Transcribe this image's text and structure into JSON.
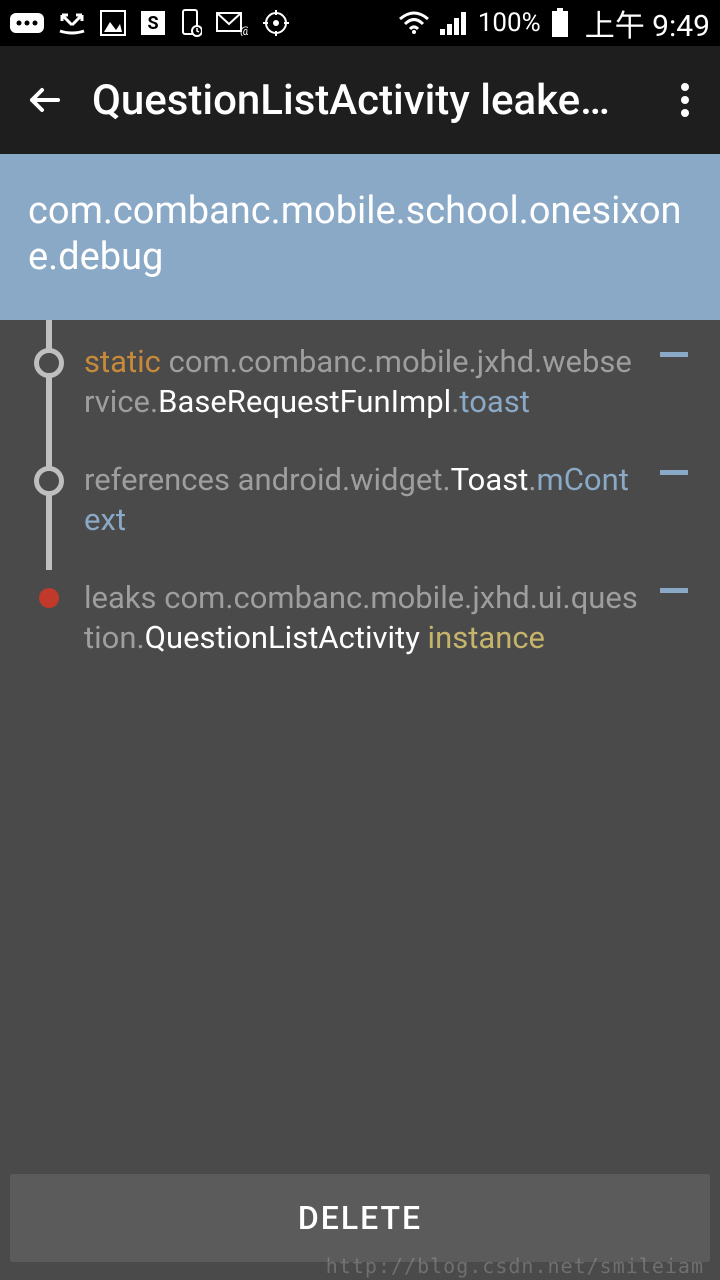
{
  "status": {
    "battery_pct": "100%",
    "time": "上午 9:49"
  },
  "appbar": {
    "title": "QuestionListActivity leake…"
  },
  "package_header": "com.combanc.mobile.school.onesixone.debug",
  "trace": [
    {
      "node": "open",
      "prefix": "static",
      "pkg1": " com.combanc.mobile.jxhd.webservice.",
      "cls": "BaseRequestFunImpl",
      "dot": ".",
      "field": "toast"
    },
    {
      "node": "open",
      "prefix": "references",
      "pkg1": " android.widget.",
      "cls": "Toast",
      "dot": ".",
      "field": "mContext"
    },
    {
      "node": "leak",
      "prefix": "leaks",
      "pkg1": " com.combanc.mobile.jxhd.ui.question.",
      "cls": "QuestionListActivity",
      "instance": " instance"
    }
  ],
  "footer": {
    "delete_label": "DELETE"
  },
  "watermark": "http://blog.csdn.net/smileiam"
}
